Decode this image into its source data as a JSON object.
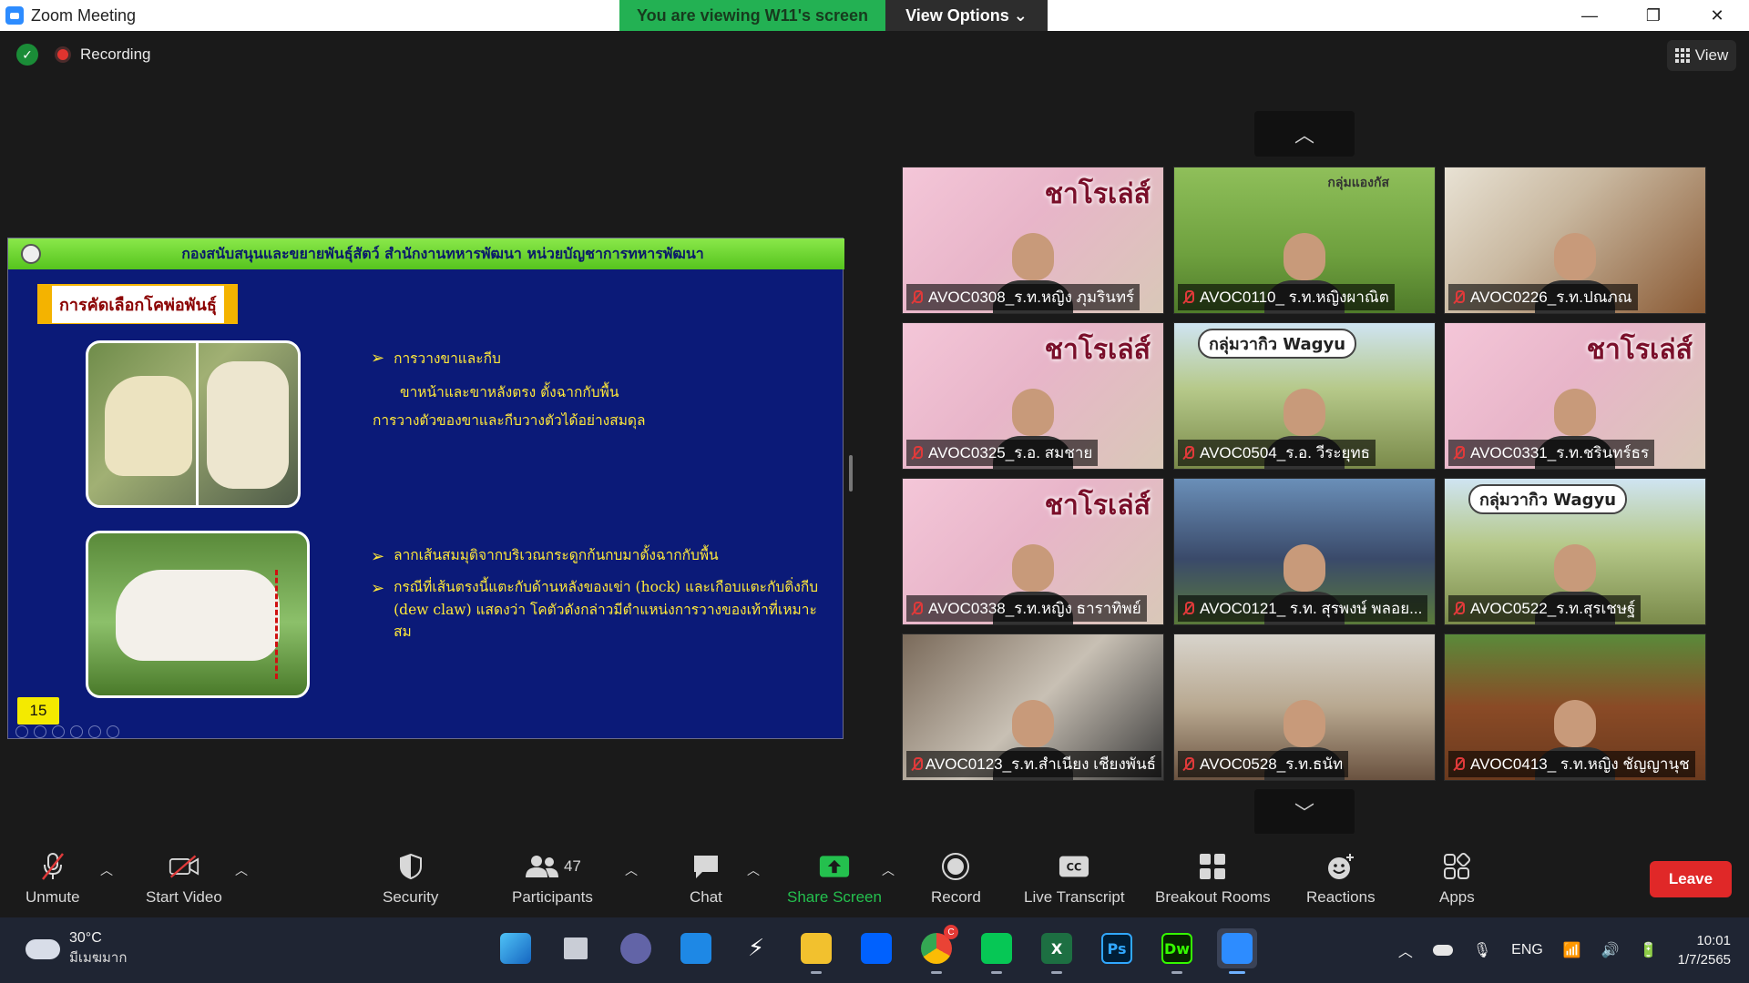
{
  "window": {
    "title": "Zoom Meeting",
    "viewing_banner": "You are viewing W11's screen",
    "view_options": "View Options ⌄",
    "minimize": "—",
    "restore": "❐",
    "close": "✕"
  },
  "meeting": {
    "recording_label": "Recording",
    "view_label": "View"
  },
  "slide": {
    "header": "กองสนับสนุนและขยายพันธุ์สัตว์ สำนักงานทหารพัฒนา หน่วยบัญชาการทหารพัฒนา",
    "topic": "การคัดเลือกโคพ่อพันธุ์",
    "bullet1": "การวางขาและกีบ",
    "bullet1_sub1": "ขาหน้าและขาหลังตรง ตั้งฉากกับพื้น",
    "bullet1_sub2": "การวางตัวของขาและกีบวางตัวได้อย่างสมดุล",
    "bullet2": "ลากเส้นสมมุติจากบริเวณกระดูกก้นกบมาตั้งฉากกับพื้น",
    "bullet3": "กรณีที่เส้นตรงนี้แตะกับด้านหลังของเข่า (hock) และเกือบแตะกับติ่งกีบ (dew claw) แสดงว่า โคตัวดังกล่าวมีตำแหน่งการวางของเท้าที่เหมาะสม",
    "page_number": "15"
  },
  "participants": [
    {
      "name": "AVOC0308_ร.ท.หญิง ภุมรินทร์",
      "sign": "ชาโรเล่ส์"
    },
    {
      "name": "AVOC0110_ ร.ท.หญิงผาณิต",
      "sign": "กลุ่มแองกัส"
    },
    {
      "name": "AVOC0226_ร.ท.ปณภณ",
      "sign": ""
    },
    {
      "name": "AVOC0325_ร.อ. สมชาย",
      "sign": "ชาโรเล่ส์"
    },
    {
      "name": "AVOC0504_ร.อ. วีระยุทธ",
      "sign": "กลุ่มวากิว Wagyu"
    },
    {
      "name": "AVOC0331_ร.ท.ชรินทร์ธร",
      "sign": "ชาโรเล่ส์"
    },
    {
      "name": "AVOC0338_ร.ท.หญิง ธาราทิพย์",
      "sign": "ชาโรเล่ส์"
    },
    {
      "name": "AVOC0121_ ร.ท. สุรพงษ์ พลอย...",
      "sign": ""
    },
    {
      "name": "AVOC0522_ร.ท.สุรเชษฐ์",
      "sign": "กลุ่มวากิว Wagyu"
    },
    {
      "name": "AVOC0123_ร.ท.สำเนียง เชียงพันธ์",
      "sign": ""
    },
    {
      "name": "AVOC0528_ร.ท.ธนัท",
      "sign": ""
    },
    {
      "name": "AVOC0413_ ร.ท.หญิง ชัญญานุช",
      "sign": ""
    }
  ],
  "toolbar": {
    "unmute": "Unmute",
    "start_video": "Start Video",
    "security": "Security",
    "participants": "Participants",
    "participant_count": "47",
    "chat": "Chat",
    "share_screen": "Share Screen",
    "record": "Record",
    "live_transcript": "Live Transcript",
    "breakout_rooms": "Breakout Rooms",
    "reactions": "Reactions",
    "apps": "Apps",
    "leave": "Leave"
  },
  "taskbar": {
    "temperature": "30°C",
    "weather_condition": "มีเมฆมาก",
    "language": "ENG",
    "time": "10:01",
    "date": "1/7/2565",
    "chrome_badge": "C"
  }
}
